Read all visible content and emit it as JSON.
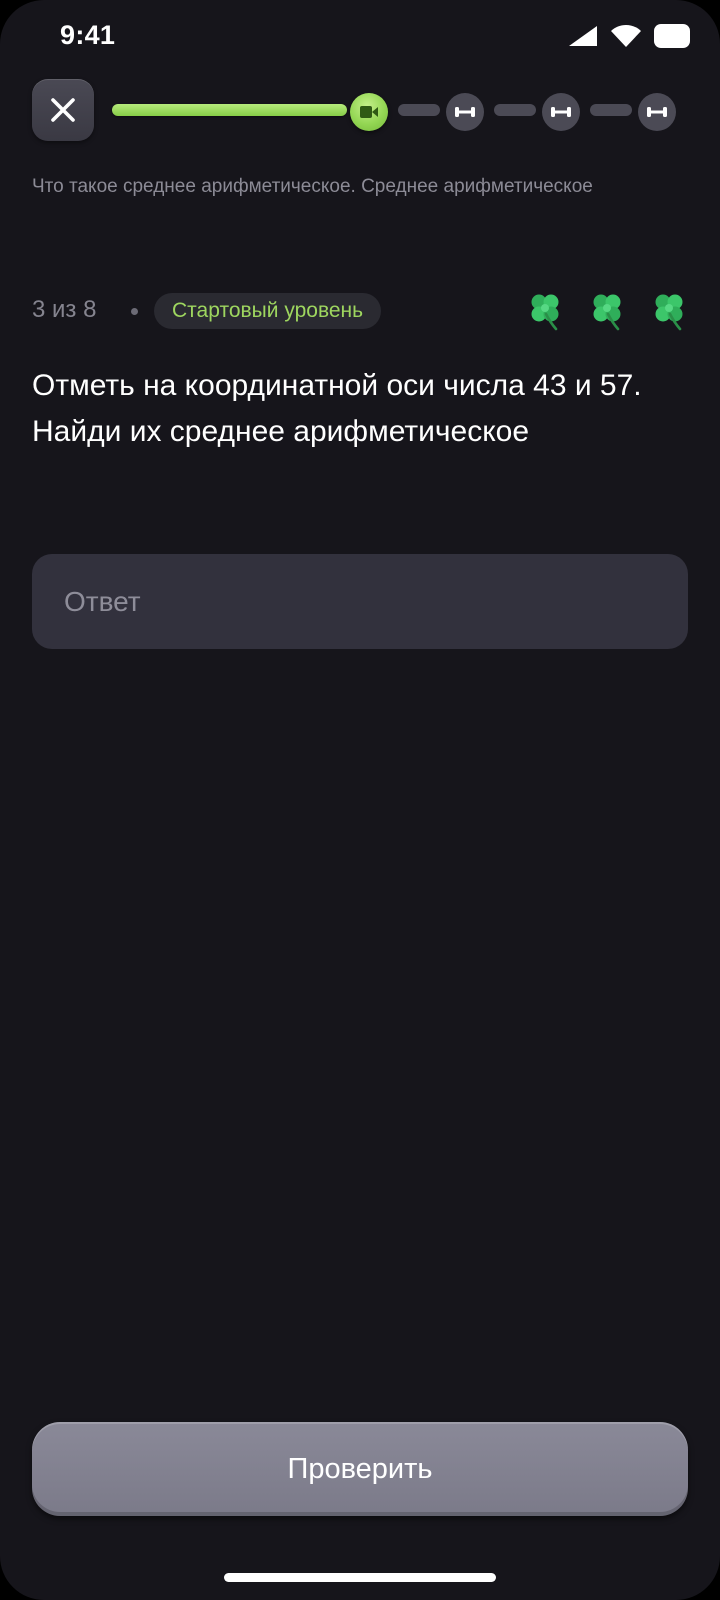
{
  "status_bar": {
    "time": "9:41",
    "icons": [
      "cellular-signal-icon",
      "wifi-icon",
      "battery-icon"
    ]
  },
  "top_bar": {
    "close_icon": "close-icon",
    "progress": {
      "steps": [
        {
          "type": "theory",
          "state": "done"
        },
        {
          "type": "video",
          "state": "current",
          "icon": "video-camera-icon"
        },
        {
          "type": "practice",
          "state": "todo",
          "icon": "dumbbell-icon"
        },
        {
          "type": "practice",
          "state": "todo",
          "icon": "dumbbell-icon"
        },
        {
          "type": "practice",
          "state": "todo",
          "icon": "dumbbell-icon"
        }
      ],
      "done_color": "#9ed65f",
      "todo_color": "#4b4a55"
    }
  },
  "lesson": {
    "title": "Что такое среднее арифметическое. Среднее арифметическое"
  },
  "task": {
    "counter": "3 из 8",
    "level": "Стартовый уровень",
    "level_color": "#9ed65f",
    "clovers": [
      "clover-icon",
      "clover-icon",
      "clover-icon"
    ],
    "question": "Отметь на координатной оси числа 43 и 57. Найди их среднее арифметическое"
  },
  "answer": {
    "placeholder": "Ответ",
    "value": ""
  },
  "actions": {
    "check_label": "Проверить"
  }
}
